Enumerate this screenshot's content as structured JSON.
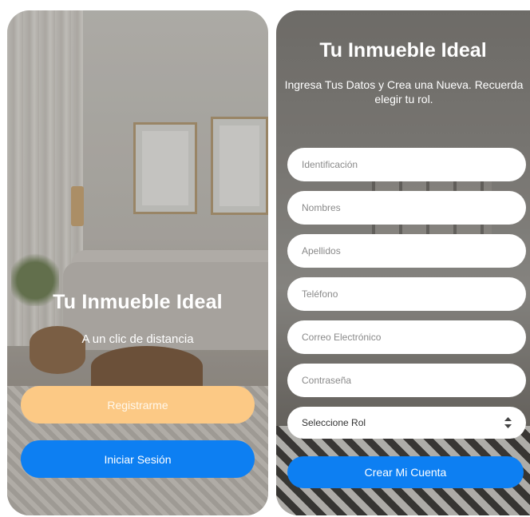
{
  "hero": {
    "title": "Tu Inmueble Ideal",
    "tagline": "A un clic de distancia",
    "register_label": "Registrarme",
    "login_label": "Iniciar Sesión"
  },
  "form": {
    "title": "Tu Inmueble Ideal",
    "subtitle": "Ingresa Tus Datos y Crea una Nueva. Recuerda elegir tu rol.",
    "fields": {
      "identification": {
        "placeholder": "Identificación",
        "value": ""
      },
      "names": {
        "placeholder": "Nombres",
        "value": ""
      },
      "lastnames": {
        "placeholder": "Apellidos",
        "value": ""
      },
      "phone": {
        "placeholder": "Teléfono",
        "value": ""
      },
      "email": {
        "placeholder": "Correo Electrónico",
        "value": ""
      },
      "password": {
        "placeholder": "Contraseña",
        "value": ""
      }
    },
    "role": {
      "selected": "Seleccione Rol",
      "icon": "sort-arrows-icon"
    },
    "submit_label": "Crear Mi Cuenta"
  },
  "colors": {
    "primary_blue": "#0d7ff2",
    "accent_orange": "#fcc985",
    "white": "#ffffff"
  }
}
